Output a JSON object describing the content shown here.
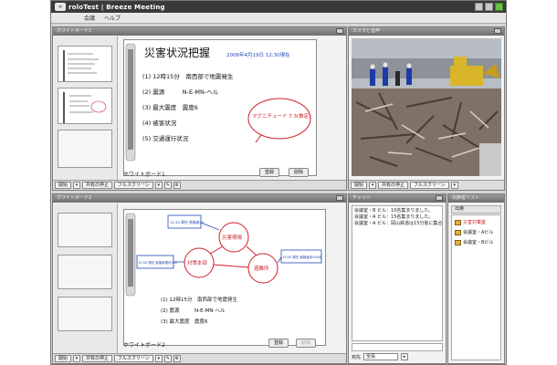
{
  "window": {
    "title": "roloTest | Breeze Meeting",
    "menu": [
      "会議",
      "ヘルプ"
    ]
  },
  "pods": {
    "whiteboard1": {
      "header": "ホワイトボード1",
      "board_label": "ホワイトボード1",
      "btn_register": "登録",
      "btn_delete": "削除",
      "toolbar": [
        "開始",
        "共有の停止",
        "フルスクリーン"
      ]
    },
    "camera": {
      "header": "カメラと音声",
      "toolbar": [
        "開始",
        "共有の停止",
        "フルスクリーン"
      ]
    },
    "whiteboard2": {
      "header": "ホワイトボード2",
      "board_label": "ホワイトボード2",
      "btn_register": "登録",
      "btn_delete": "削除",
      "toolbar": [
        "開始",
        "共有の停止",
        "フルスクリーン"
      ]
    },
    "chat": {
      "header": "チャット",
      "messages": [
        "会議室・B ビル：10名集まりました。",
        "会議室・A ビル：15名集まりました。",
        "会議室・A ビル：岡山鉄道は15分後に集合"
      ],
      "send_label": "宛先",
      "send_target": "全員"
    },
    "attendees": {
      "header": "出席者リスト",
      "list_header": "出席",
      "items": [
        "災害対策室",
        "会議室・Aビル",
        "会議室・Bビル"
      ]
    }
  },
  "whiteboard_ink": {
    "wb1": {
      "title": "災害状況把握",
      "timestamp": "2006年4月19日 12:30現在",
      "lines": [
        "(1) 12時15分　南西部で地震発生",
        "(2) 震源　　　N-E-MN-ヘル",
        "(3) 最大震度　震度6",
        "(4) 被害状況",
        "(5) 交通運行状況"
      ],
      "note": "マグニチュード 7.3(推定)"
    },
    "wb2": {
      "nodes": [
        "災害現場",
        "対策本部",
        "避難所"
      ],
      "boxes": [
        "12:45 現在 負傷者50",
        "12:50 現在 被害家屋約150",
        "13:00 現在 避難者約300名"
      ],
      "lines": [
        "(1) 12時15分　南西部で地震発生",
        "(2) 震源　　　N-E-MN-ヘル",
        "(3) 最大震度　震度6"
      ]
    }
  },
  "colors": {
    "titlebar": "#3a3a3a",
    "pod_header": "#7a7a7a",
    "ink_red": "#d01f2a",
    "ink_blue": "#1f4ab5"
  }
}
